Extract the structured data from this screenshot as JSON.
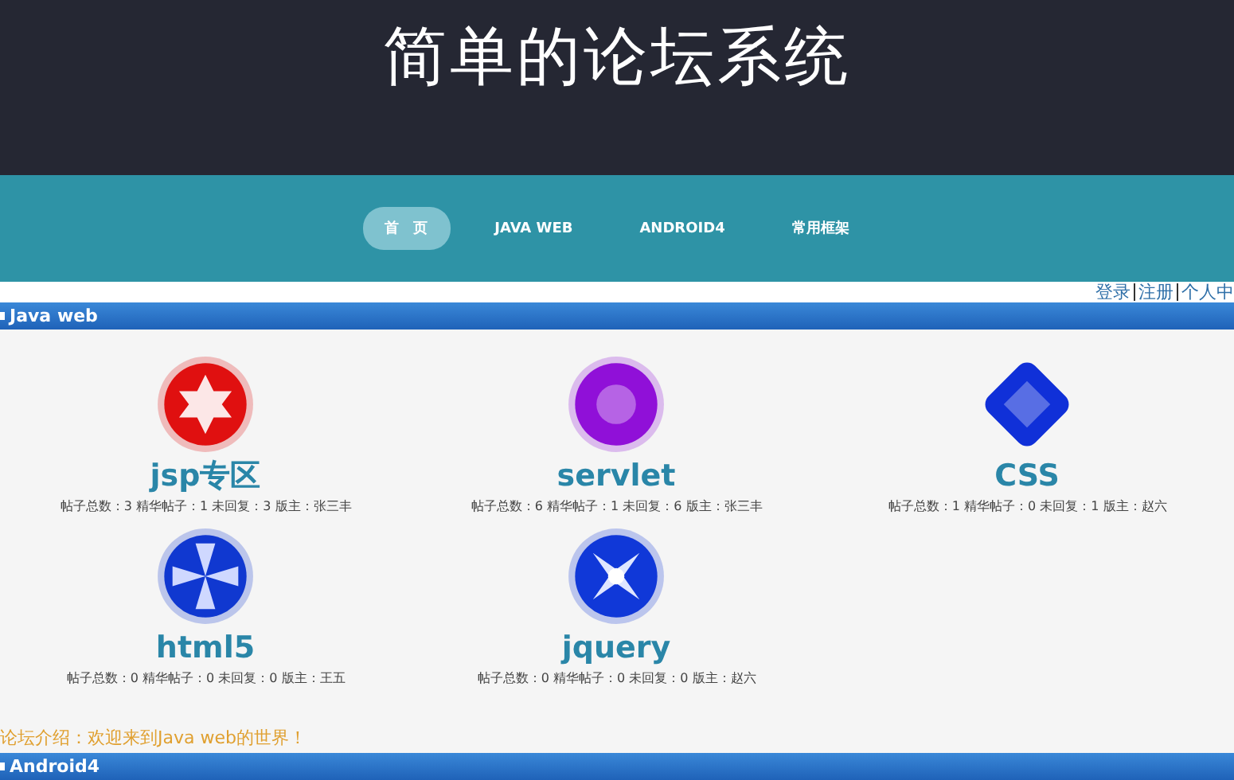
{
  "header": {
    "title": "简单的论坛系统"
  },
  "nav": [
    {
      "label": "首　页",
      "selected": true
    },
    {
      "label": "JAVA WEB",
      "selected": false
    },
    {
      "label": "ANDROID4",
      "selected": false
    },
    {
      "label": "常用框架",
      "selected": false
    }
  ],
  "user_links": [
    "登录",
    "注册",
    "个人中"
  ],
  "sections": [
    {
      "title": "Java web",
      "forums": [
        {
          "name": "jsp专区",
          "stats": "帖子总数：3 精华帖子：1 未回复：3 版主：张三丰",
          "kind": "star",
          "color": "#e01010"
        },
        {
          "name": "servlet",
          "stats": "帖子总数：6 精华帖子：1 未回复：6 版主：张三丰",
          "kind": "circle",
          "color": "#9010d8"
        },
        {
          "name": "CSS",
          "stats": "帖子总数：1 精华帖子：0 未回复：1 版主：赵六",
          "kind": "diamond",
          "color": "#1030d8"
        },
        {
          "name": "html5",
          "stats": "帖子总数：0 精华帖子：0 未回复：0 版主：王五",
          "kind": "pinwheel",
          "color": "#1038d0"
        },
        {
          "name": "jquery",
          "stats": "帖子总数：0 精华帖子：0 未回复：0 版主：赵六",
          "kind": "sparkle",
          "color": "#1038d8"
        }
      ],
      "intro": "论坛介绍：欢迎来到Java web的世界！"
    },
    {
      "title": "Android4"
    }
  ]
}
